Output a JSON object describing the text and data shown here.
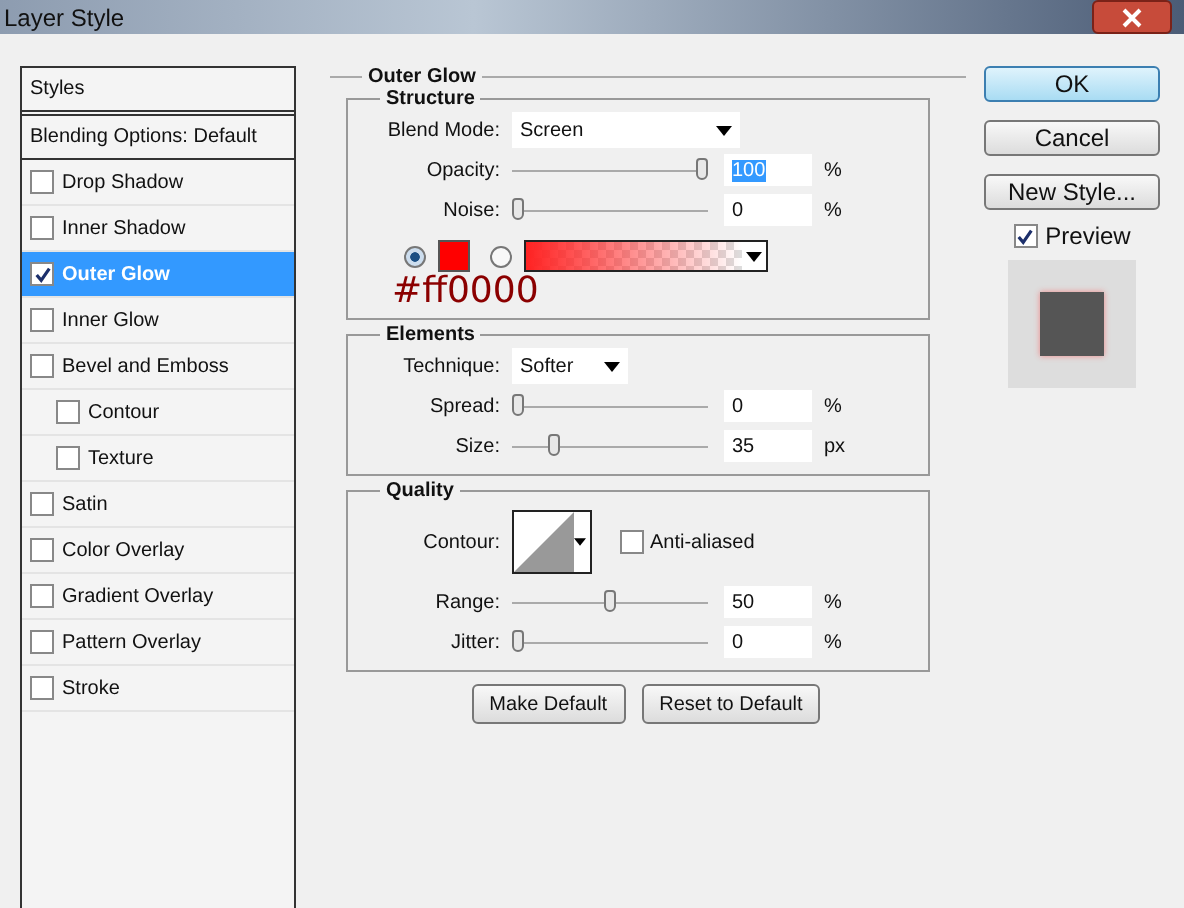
{
  "window": {
    "title": "Layer Style"
  },
  "sidebar": {
    "header": "Styles",
    "blending": "Blending Options: Default",
    "items": [
      {
        "label": "Drop Shadow",
        "checked": false,
        "selected": false
      },
      {
        "label": "Inner Shadow",
        "checked": false,
        "selected": false
      },
      {
        "label": "Outer Glow",
        "checked": true,
        "selected": true
      },
      {
        "label": "Inner Glow",
        "checked": false,
        "selected": false
      },
      {
        "label": "Bevel and Emboss",
        "checked": false,
        "selected": false,
        "children": [
          {
            "label": "Contour",
            "checked": false,
            "selected": false
          },
          {
            "label": "Texture",
            "checked": false,
            "selected": false
          }
        ]
      },
      {
        "label": "Satin",
        "checked": false,
        "selected": false
      },
      {
        "label": "Color Overlay",
        "checked": false,
        "selected": false
      },
      {
        "label": "Gradient Overlay",
        "checked": false,
        "selected": false
      },
      {
        "label": "Pattern Overlay",
        "checked": false,
        "selected": false
      },
      {
        "label": "Stroke",
        "checked": false,
        "selected": false
      }
    ]
  },
  "panel": {
    "title": "Outer Glow",
    "structure": {
      "title": "Structure",
      "blend_mode": {
        "label": "Blend Mode:",
        "value": "Screen"
      },
      "sliders": [
        {
          "label": "Opacity:",
          "level": 1.0,
          "value": "100",
          "unit": "%",
          "highlighted": true
        },
        {
          "label": "Noise:",
          "level": 0,
          "value": "0",
          "unit": "%",
          "highlighted": false
        }
      ],
      "color_source": [
        {
          "kind": "solid",
          "selected": true,
          "color": "#ff0000"
        },
        {
          "kind": "gradient",
          "selected": false
        }
      ],
      "annotation": "#ff0000"
    },
    "elements": {
      "title": "Elements",
      "technique": {
        "label": "Technique:",
        "value": "Softer"
      },
      "sliders": [
        {
          "label": "Spread:",
          "level": 0,
          "value": "0",
          "unit": "%",
          "highlighted": false
        },
        {
          "label": "Size:",
          "level": 0.2,
          "value": "35",
          "unit": "px",
          "highlighted": false
        }
      ]
    },
    "quality": {
      "title": "Quality",
      "contour_label": "Contour:",
      "anti_aliased": {
        "label": "Anti-aliased",
        "checked": false
      },
      "sliders": [
        {
          "label": "Range:",
          "level": 0.5,
          "value": "50",
          "unit": "%",
          "highlighted": false
        },
        {
          "label": "Jitter:",
          "level": 0,
          "value": "0",
          "unit": "%",
          "highlighted": false
        }
      ]
    },
    "buttons": [
      "Make Default",
      "Reset to Default"
    ]
  },
  "actions": [
    {
      "label": "OK",
      "default": true
    },
    {
      "label": "Cancel",
      "default": false
    },
    {
      "label": "New Style...",
      "default": false
    }
  ],
  "preview": {
    "label": "Preview",
    "checked": true
  }
}
